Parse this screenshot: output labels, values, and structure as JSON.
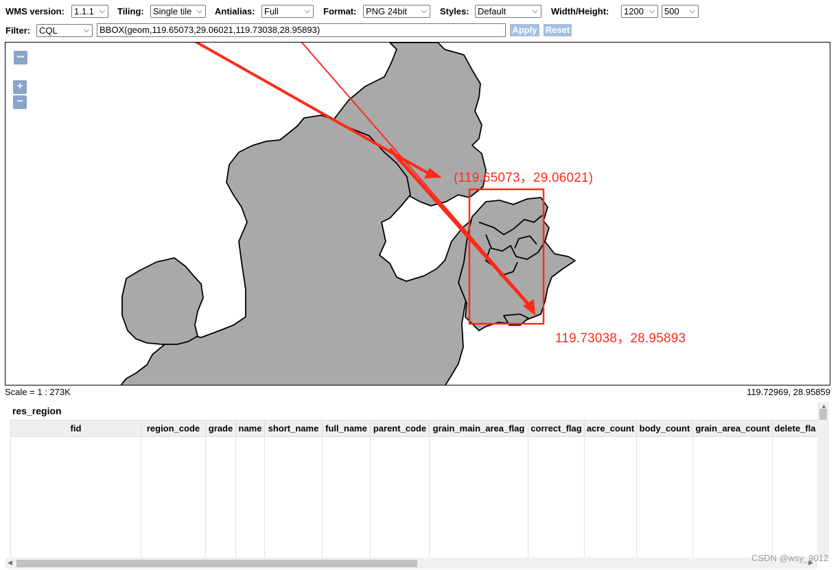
{
  "toolbar": {
    "wms_version": {
      "label": "WMS version:",
      "value": "1.1.1"
    },
    "tiling": {
      "label": "Tiling:",
      "value": "Single tile"
    },
    "antialias": {
      "label": "Antialias:",
      "value": "Full"
    },
    "format": {
      "label": "Format:",
      "value": "PNG 24bit"
    },
    "styles": {
      "label": "Styles:",
      "value": "Default"
    },
    "size": {
      "label": "Width/Height:",
      "width": "1200",
      "height": "500"
    },
    "filter": {
      "label": "Filter:",
      "type": "CQL",
      "value": "BBOX(geom,119.65073,29.06021,119.73038,28.95893)"
    },
    "apply_label": "Apply",
    "reset_label": "Reset"
  },
  "map": {
    "toggle_label": "•••",
    "zoom_in": "+",
    "zoom_out": "−",
    "annotation_top": "(119.65073，29.06021)",
    "annotation_bottom": "119.73038，28.95893",
    "annotation_color": "#ff2a1a",
    "region_fill": "#a9a9a9"
  },
  "status": {
    "scale": "Scale = 1 : 273K",
    "coords": "119.72969, 28.95859"
  },
  "layer": {
    "title": "res_region",
    "columns": [
      "fid",
      "region_code",
      "grade",
      "name",
      "short_name",
      "full_name",
      "parent_code",
      "grain_main_area_flag",
      "correct_flag",
      "acre_count",
      "body_count",
      "grain_area_count",
      "delete_fla"
    ]
  },
  "watermark": "CSDN @wsy_9012"
}
